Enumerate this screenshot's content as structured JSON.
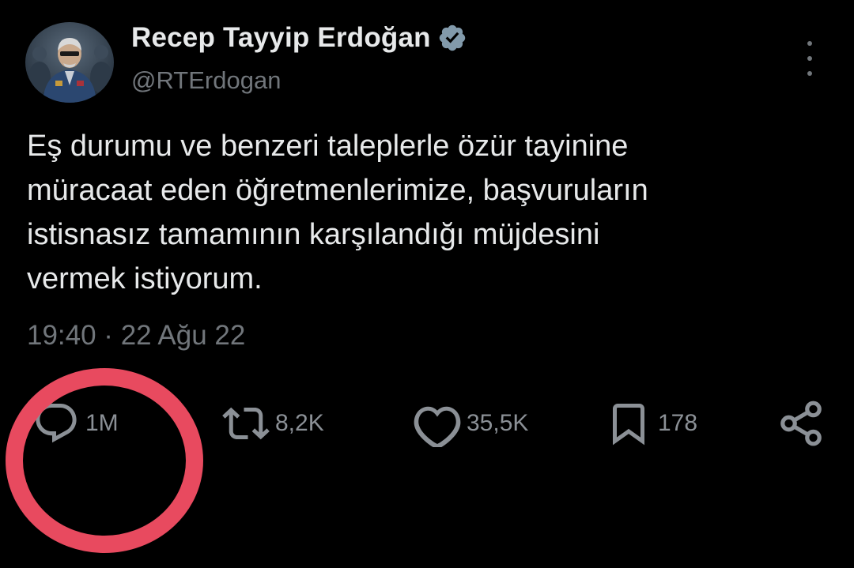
{
  "tweet": {
    "author": {
      "display_name": "Recep Tayyip Erdoğan",
      "handle": "@RTErdogan",
      "verified": true,
      "avatar_icon": "avatar-photo"
    },
    "text": "Eş durumu ve benzeri taleplerle özür tayinine\nmüracaat eden öğretmenlerimize, başvuruların\nistisnasız tamamının karşılandığı müjdesini\nvermek istiyorum.",
    "timestamp": "19:40 · 22 Ağu 22",
    "metrics": {
      "replies": "1M",
      "retweets": "8,2K",
      "likes": "35,5K",
      "bookmarks": "178"
    },
    "icons": {
      "reply": "reply-icon",
      "retweet": "retweet-icon",
      "like": "heart-icon",
      "bookmark": "bookmark-icon",
      "share": "share-icon",
      "more": "more-options-icon",
      "verified": "verified-badge-icon"
    }
  },
  "colors": {
    "background": "#000000",
    "primary_text": "#e7e9ea",
    "secondary_text": "#71767b",
    "icon": "#8b9096",
    "verified_badge": "#829aab",
    "highlight_circle": "#e84a5f"
  }
}
